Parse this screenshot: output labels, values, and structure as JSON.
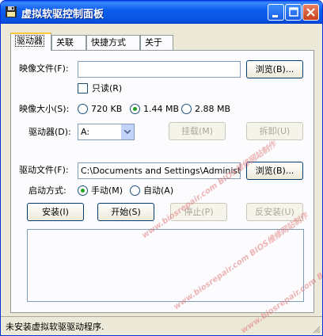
{
  "window": {
    "title": "虚拟软驱控制面板"
  },
  "tabs": [
    {
      "label": "驱动器"
    },
    {
      "label": "关联"
    },
    {
      "label": "快捷方式"
    },
    {
      "label": "关于"
    }
  ],
  "image_file": {
    "label": "映像文件(F):",
    "value": "",
    "browse_label": "浏览(B)..."
  },
  "readonly": {
    "label": "只读(R)",
    "checked": false
  },
  "image_size": {
    "label": "映像大小(S):",
    "options": [
      {
        "label": "720 KB",
        "selected": false
      },
      {
        "label": "1.44 MB",
        "selected": true
      },
      {
        "label": "2.88 MB",
        "selected": false
      }
    ]
  },
  "drive": {
    "label": "驱动器(D):",
    "value": "A:",
    "mount_label": "挂载(M)",
    "unmount_label": "拆卸(U)"
  },
  "driver_file": {
    "label": "驱动文件(F):",
    "value": "C:\\Documents and Settings\\Administrator\\",
    "browse_label": "浏览(B)..."
  },
  "start_mode": {
    "label": "启动方式:",
    "options": [
      {
        "label": "手动(M)",
        "selected": true
      },
      {
        "label": "自动(A)",
        "selected": false
      }
    ]
  },
  "actions": {
    "install_label": "安装(I)",
    "start_label": "开始(S)",
    "stop_label": "停止(P)",
    "uninstall_label": "反安装(U)"
  },
  "status": {
    "text": "未安装虚拟软驱驱动程序."
  },
  "watermark": {
    "text": "www.biosrepair.com BIOS维修网站制作"
  },
  "colors": {
    "title_bar": "#0b5fef",
    "active_tab_accent": "#ffc83c",
    "radio_dot": "#21a121",
    "watermark": "#e07a7a"
  }
}
